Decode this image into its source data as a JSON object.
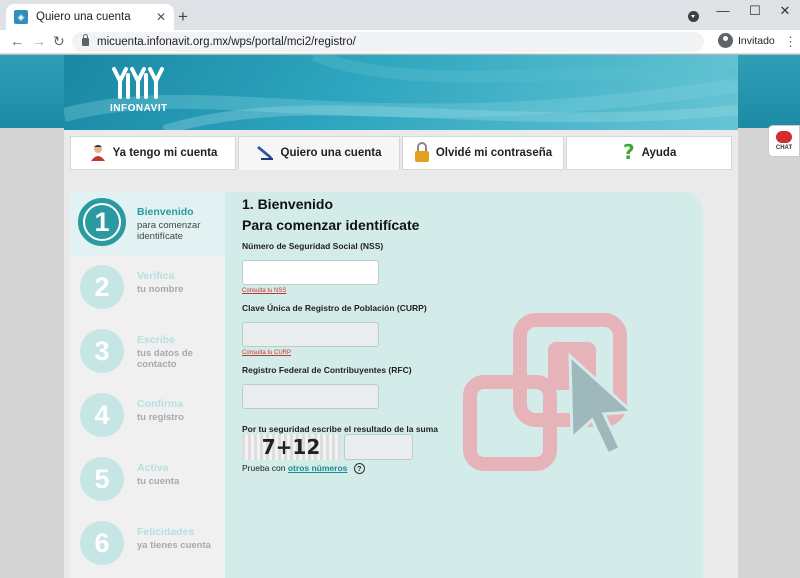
{
  "browser": {
    "tab_title": "Quiero una cuenta",
    "new_tab": "+",
    "url": "micuenta.infonavit.org.mx/wps/portal/mci2/registro/",
    "profile_label": "Invitado",
    "window_controls": [
      "—",
      "☐",
      "✕"
    ]
  },
  "header": {
    "logo_text": "INFONAVIT"
  },
  "tabs": [
    {
      "label": "Ya tengo mi cuenta",
      "icon": "user-icon"
    },
    {
      "label": "Quiero una cuenta",
      "icon": "pen-icon",
      "active": true
    },
    {
      "label": "Olvidé mi contraseña",
      "icon": "padlock-icon"
    },
    {
      "label": "Ayuda",
      "icon": "question-icon"
    }
  ],
  "chat": {
    "label": "CHAT"
  },
  "steps": [
    {
      "num": "1",
      "title": "Bienvenido",
      "subtitle": "para comenzar identifícate",
      "active": true
    },
    {
      "num": "2",
      "title": "Verifica",
      "subtitle": "tu nombre"
    },
    {
      "num": "3",
      "title": "Escribe",
      "subtitle": "tus datos de contacto"
    },
    {
      "num": "4",
      "title": "Confirma",
      "subtitle": "tu registro"
    },
    {
      "num": "5",
      "title": "Activa",
      "subtitle": "tu cuenta"
    },
    {
      "num": "6",
      "title": "Felicidades",
      "subtitle": "ya tienes cuenta"
    }
  ],
  "form": {
    "heading": "1. Bienvenido",
    "subheading": "Para comenzar identifícate",
    "nss_label": "Número de Seguridad Social (NSS)",
    "nss_value": "",
    "nss_link": "Consulta tu NSS",
    "curp_label": "Clave Única de Registro de Población (CURP)",
    "curp_value": "",
    "curp_link": "Consulta tu CURP",
    "rfc_label": "Registro Federal de Contribuyentes (RFC)",
    "rfc_value": "",
    "captcha_label": "Por tu seguridad escribe el resultado de la suma",
    "captcha_text": "7+12",
    "captcha_value": "",
    "retry_prefix": "Prueba con",
    "retry_link": "otros números",
    "help": "?"
  },
  "colors": {
    "accent": "#2a9aa0",
    "panel": "#d3ecea",
    "link_red": "#c0392b"
  }
}
